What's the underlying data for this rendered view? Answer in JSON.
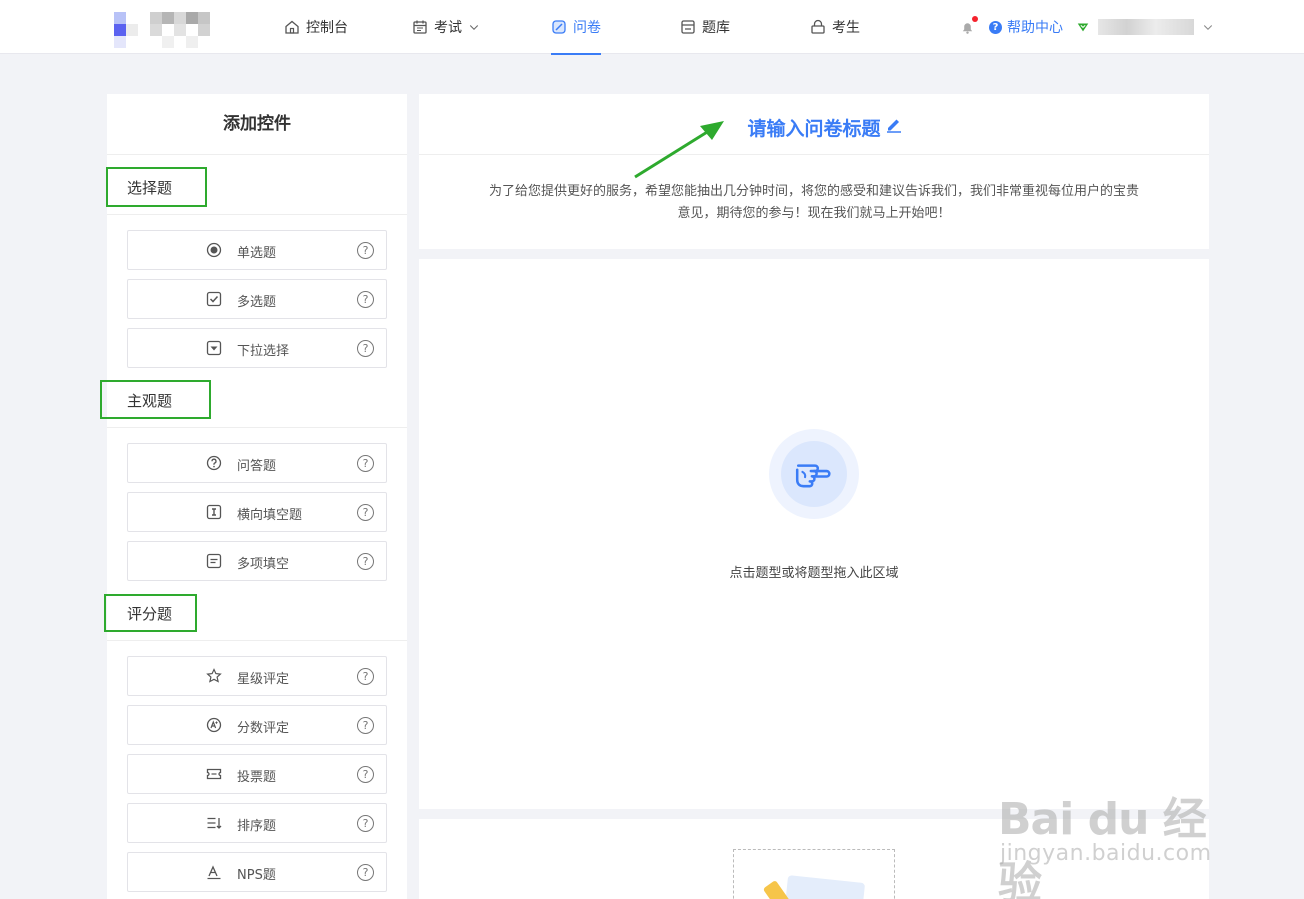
{
  "nav": {
    "items": [
      {
        "label": "控制台",
        "icon": "home-icon"
      },
      {
        "label": "考试",
        "icon": "calendar-icon"
      },
      {
        "label": "问卷",
        "icon": "survey-icon"
      },
      {
        "label": "题库",
        "icon": "database-icon"
      },
      {
        "label": "考生",
        "icon": "lock-icon"
      }
    ],
    "active": "问卷",
    "help_label": "帮助中心"
  },
  "left_panel": {
    "title": "添加控件",
    "sections": [
      {
        "title": "选择题",
        "items": [
          {
            "label": "单选题",
            "icon": "radio-icon"
          },
          {
            "label": "多选题",
            "icon": "checkbox-icon"
          },
          {
            "label": "下拉选择",
            "icon": "dropdown-icon"
          }
        ]
      },
      {
        "title": "主观题",
        "items": [
          {
            "label": "问答题",
            "icon": "question-icon"
          },
          {
            "label": "横向填空题",
            "icon": "text-cursor-icon"
          },
          {
            "label": "多项填空",
            "icon": "multi-fill-icon"
          }
        ]
      },
      {
        "title": "评分题",
        "items": [
          {
            "label": "星级评定",
            "icon": "star-icon"
          },
          {
            "label": "分数评定",
            "icon": "score-icon"
          },
          {
            "label": "投票题",
            "icon": "ticket-icon"
          },
          {
            "label": "排序题",
            "icon": "sort-icon"
          },
          {
            "label": "NPS题",
            "icon": "nps-icon"
          }
        ]
      }
    ],
    "help_glyph": "?"
  },
  "survey": {
    "title": "请输入问卷标题",
    "description": "为了给您提供更好的服务，希望您能抽出几分钟时间，将您的感受和建议告诉我们，我们非常重视每位用户的宝贵意见，期待您的参与！现在我们就马上开始吧！"
  },
  "dropzone": {
    "hint": "点击题型或将题型拖入此区域"
  },
  "watermark": {
    "line1": "Bai du 经验",
    "line2": "jingyan.baidu.com"
  },
  "colors": {
    "accent": "#3a7cf6",
    "highlight": "#2eaa2e",
    "background": "#f2f3f7"
  }
}
